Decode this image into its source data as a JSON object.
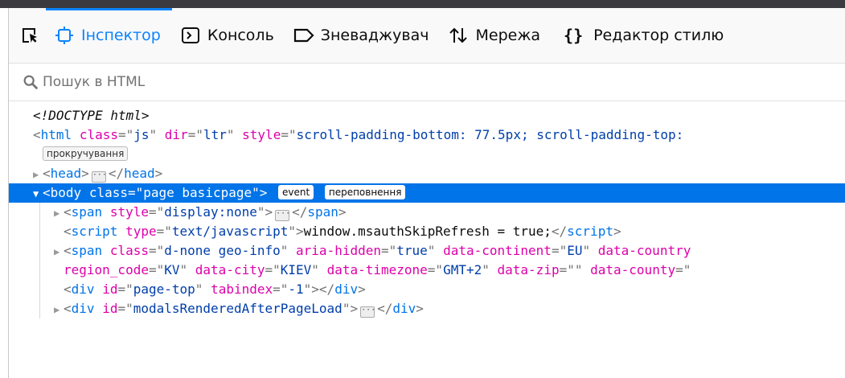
{
  "toolbar": {
    "tabs": [
      {
        "label": "Інспектор",
        "icon": "inspector-icon"
      },
      {
        "label": "Консоль",
        "icon": "console-icon"
      },
      {
        "label": "Зневаджувач",
        "icon": "debugger-icon"
      },
      {
        "label": "Мережа",
        "icon": "network-icon"
      },
      {
        "label": "Редактор стилю",
        "icon": "style-editor-icon"
      }
    ],
    "picker_icon": "element-picker-icon"
  },
  "search": {
    "placeholder": "Пошук в HTML",
    "value": ""
  },
  "tree": {
    "doctype": "<!DOCTYPE html>",
    "html_open": {
      "tag": "html",
      "attrs": [
        [
          "class",
          "js"
        ],
        [
          "dir",
          "ltr"
        ],
        [
          "style",
          "scroll-padding-bottom: 77.5px; scroll-padding-top:"
        ]
      ]
    },
    "html_badge": "прокручування",
    "head": "head",
    "body": {
      "tag": "body",
      "attrs": [
        [
          "class",
          "page basicpage"
        ]
      ],
      "badges": [
        "event",
        "переповнення"
      ]
    },
    "span1": {
      "tag": "span",
      "attrs": [
        [
          "style",
          "display:none"
        ]
      ]
    },
    "script": {
      "tag": "script",
      "attrs": [
        [
          "type",
          "text/javascript"
        ]
      ],
      "text": "window.msauthSkipRefresh = true;"
    },
    "span2": {
      "tag": "span",
      "line1": [
        [
          "class",
          "d-none geo-info"
        ],
        [
          "aria-hidden",
          "true"
        ],
        [
          "data-continent",
          "EU"
        ],
        [
          "data-country",
          ""
        ]
      ],
      "line2": [
        [
          "region_code",
          "KV"
        ],
        [
          "data-city",
          "KIEV"
        ],
        [
          "data-timezone",
          "GMT+2"
        ],
        [
          "data-zip",
          ""
        ],
        [
          "data-county",
          ""
        ]
      ]
    },
    "div1": {
      "tag": "div",
      "attrs": [
        [
          "id",
          "page-top"
        ],
        [
          "tabindex",
          "-1"
        ]
      ]
    },
    "div2": {
      "tag": "div",
      "attrs": [
        [
          "id",
          "modalsRenderedAfterPageLoad"
        ]
      ]
    }
  },
  "colors": {
    "accent": "#0a84ff",
    "selection": "#0074e8",
    "tag": "#0074e8",
    "attr": "#dd00a9",
    "value": "#003eaa"
  }
}
